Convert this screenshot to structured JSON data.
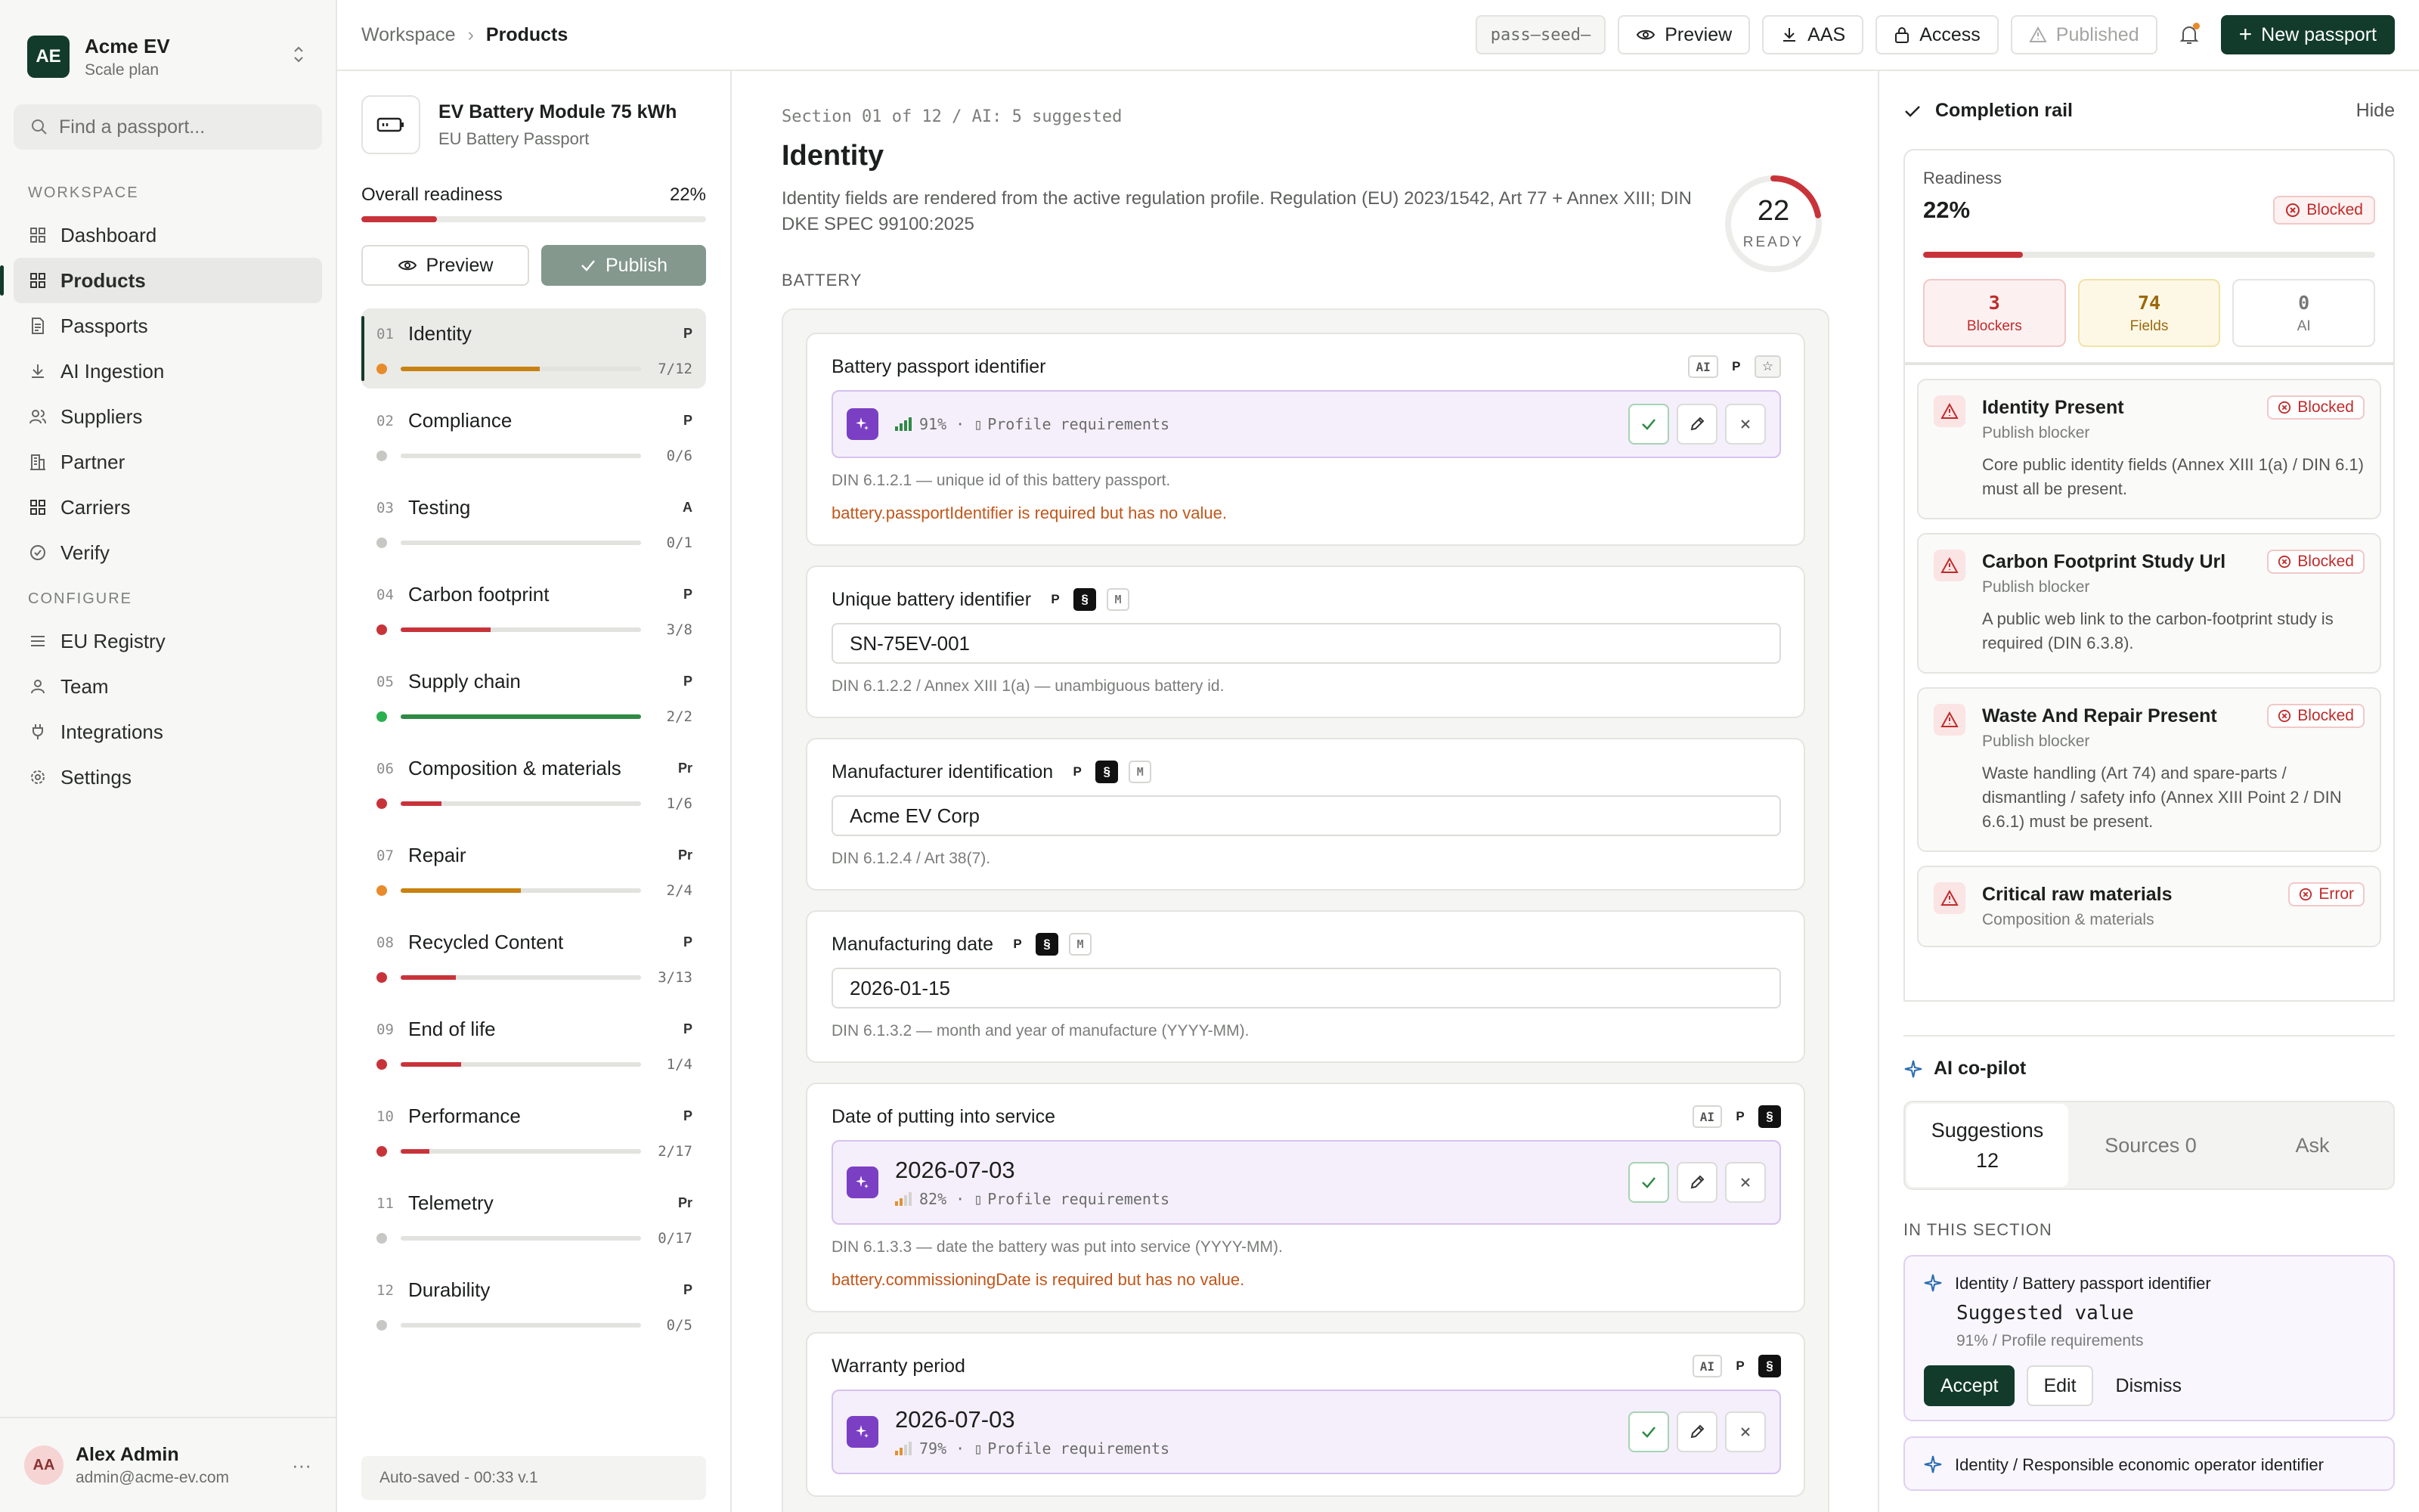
{
  "org": {
    "badge": "AE",
    "name": "Acme EV",
    "plan": "Scale plan"
  },
  "search": {
    "placeholder": "Find a passport..."
  },
  "nav": {
    "workspace_label": "WORKSPACE",
    "workspace": [
      {
        "label": "Dashboard",
        "icon": "dashboard-icon"
      },
      {
        "label": "Products",
        "icon": "grid-icon",
        "active": true
      },
      {
        "label": "Passports",
        "icon": "document-icon"
      },
      {
        "label": "AI Ingestion",
        "icon": "download-icon"
      },
      {
        "label": "Suppliers",
        "icon": "users-icon"
      },
      {
        "label": "Partner",
        "icon": "building-icon"
      },
      {
        "label": "Carriers",
        "icon": "grid-icon"
      },
      {
        "label": "Verify",
        "icon": "check-circle-icon"
      }
    ],
    "configure_label": "CONFIGURE",
    "configure": [
      {
        "label": "EU Registry",
        "icon": "list-icon"
      },
      {
        "label": "Team",
        "icon": "user-icon"
      },
      {
        "label": "Integrations",
        "icon": "plug-icon"
      },
      {
        "label": "Settings",
        "icon": "gear-icon"
      }
    ]
  },
  "user": {
    "initials": "AA",
    "name": "Alex Admin",
    "email": "admin@acme-ev.com"
  },
  "topbar": {
    "crumb_root": "Workspace",
    "crumb_current": "Products",
    "seed": "pass—seed—",
    "preview": "Preview",
    "aas": "AAS",
    "access": "Access",
    "published": "Published",
    "new_passport": "New passport"
  },
  "product": {
    "name": "EV Battery Module 75 kWh",
    "subtitle": "EU Battery Passport",
    "readiness_label": "Overall readiness",
    "readiness_pct": "22%",
    "readiness_value": 0.22,
    "preview": "Preview",
    "publish": "Publish",
    "autosave": "Auto-saved - 00:33 v.1",
    "sections": [
      {
        "num": "01",
        "title": "Identity",
        "tag": "P",
        "count": "7/12",
        "progress": 0.58,
        "color": "#c8820f",
        "dot": "#e88b2b",
        "active": true
      },
      {
        "num": "02",
        "title": "Compliance",
        "tag": "P",
        "count": "0/6",
        "progress": 0,
        "color": "#c7c7c4",
        "dot": "#c7c7c4"
      },
      {
        "num": "03",
        "title": "Testing",
        "tag": "A",
        "count": "0/1",
        "progress": 0,
        "color": "#c7c7c4",
        "dot": "#c7c7c4"
      },
      {
        "num": "04",
        "title": "Carbon footprint",
        "tag": "P",
        "count": "3/8",
        "progress": 0.375,
        "color": "#c8333a",
        "dot": "#c8333a"
      },
      {
        "num": "05",
        "title": "Supply chain",
        "tag": "P",
        "count": "2/2",
        "progress": 1,
        "color": "#2f8a44",
        "dot": "#2bb04f"
      },
      {
        "num": "06",
        "title": "Composition & materials",
        "tag": "Pr",
        "count": "1/6",
        "progress": 0.17,
        "color": "#c8333a",
        "dot": "#c8333a"
      },
      {
        "num": "07",
        "title": "Repair",
        "tag": "Pr",
        "count": "2/4",
        "progress": 0.5,
        "color": "#c8820f",
        "dot": "#e88b2b"
      },
      {
        "num": "08",
        "title": "Recycled Content",
        "tag": "P",
        "count": "3/13",
        "progress": 0.23,
        "color": "#c8333a",
        "dot": "#c8333a"
      },
      {
        "num": "09",
        "title": "End of life",
        "tag": "P",
        "count": "1/4",
        "progress": 0.25,
        "color": "#c8333a",
        "dot": "#c8333a"
      },
      {
        "num": "10",
        "title": "Performance",
        "tag": "P",
        "count": "2/17",
        "progress": 0.12,
        "color": "#c8333a",
        "dot": "#c8333a"
      },
      {
        "num": "11",
        "title": "Telemetry",
        "tag": "Pr",
        "count": "0/17",
        "progress": 0,
        "color": "#c7c7c4",
        "dot": "#c7c7c4"
      },
      {
        "num": "12",
        "title": "Durability",
        "tag": "P",
        "count": "0/5",
        "progress": 0,
        "color": "#c7c7c4",
        "dot": "#c7c7c4"
      }
    ]
  },
  "form": {
    "meta": "Section 01 of 12 / AI: 5 suggested",
    "title": "Identity",
    "description": "Identity fields are rendered from the active regulation profile. Regulation (EU) 2023/1542, Art 77 + Annex XIII; DIN DKE SPEC 99100:2025",
    "ring_value": "22",
    "ring_fraction": 0.22,
    "ring_label": "READY",
    "group_label": "BATTERY",
    "fields": [
      {
        "label": "Battery passport identifier",
        "badges": [
          "AI",
          "P",
          "star"
        ],
        "badges_inline": false,
        "kind": "suggestion",
        "value": "",
        "confidence": "91%",
        "strength": "high",
        "source": "Profile requirements",
        "help": "DIN 6.1.2.1 — unique id of this battery passport.",
        "error": "battery.passportIdentifier is required but has no value."
      },
      {
        "label": "Unique battery identifier",
        "badges": [
          "P",
          "§",
          "M"
        ],
        "badges_inline": true,
        "kind": "input",
        "value": "SN-75EV-001",
        "help": "DIN 6.1.2.2 / Annex XIII 1(a) — unambiguous battery id.",
        "error": ""
      },
      {
        "label": "Manufacturer identification",
        "badges": [
          "P",
          "§",
          "M"
        ],
        "badges_inline": true,
        "kind": "input",
        "value": "Acme EV Corp",
        "help": "DIN 6.1.2.4 / Art 38(7).",
        "error": ""
      },
      {
        "label": "Manufacturing date",
        "badges": [
          "P",
          "§",
          "M"
        ],
        "badges_inline": true,
        "kind": "input",
        "value": "2026-01-15",
        "help": "DIN 6.1.3.2 — month and year of manufacture (YYYY-MM).",
        "error": ""
      },
      {
        "label": "Date of putting into service",
        "badges": [
          "AI",
          "P",
          "§"
        ],
        "badges_inline": false,
        "kind": "suggestion",
        "value": "2026-07-03",
        "confidence": "82%",
        "strength": "mid",
        "source": "Profile requirements",
        "help": "DIN 6.1.3.3 — date the battery was put into service (YYYY-MM).",
        "error": "battery.commissioningDate is required but has no value."
      },
      {
        "label": "Warranty period",
        "badges": [
          "AI",
          "P",
          "§"
        ],
        "badges_inline": false,
        "kind": "suggestion",
        "value": "2026-07-03",
        "confidence": "79%",
        "strength": "mid",
        "source": "Profile requirements",
        "help": "",
        "error": ""
      }
    ]
  },
  "rail": {
    "title": "Completion rail",
    "hide": "Hide",
    "readiness_label": "Readiness",
    "readiness_pct": "22%",
    "readiness_value": 0.22,
    "status": "Blocked",
    "stats": [
      {
        "n": "3",
        "label": "Blockers",
        "tone": "red"
      },
      {
        "n": "74",
        "label": "Fields",
        "tone": "amber"
      },
      {
        "n": "0",
        "label": "AI",
        "tone": "gray"
      }
    ],
    "blockers": [
      {
        "title": "Identity Present",
        "status": "Blocked",
        "sub": "Publish blocker",
        "desc": "Core public identity fields (Annex XIII 1(a) / DIN 6.1) must all be present."
      },
      {
        "title": "Carbon Footprint Study Url",
        "status": "Blocked",
        "sub": "Publish blocker",
        "desc": "A public web link to the carbon-footprint study is required (DIN 6.3.8)."
      },
      {
        "title": "Waste And Repair Present",
        "status": "Blocked",
        "sub": "Publish blocker",
        "desc": "Waste handling (Art 74) and spare-parts / dismantling / safety info (Annex XIII Point 2 / DIN 6.6.1) must be present."
      },
      {
        "title": "Critical raw materials",
        "status": "Error",
        "sub": "Composition & materials",
        "desc": ""
      }
    ],
    "copilot": {
      "title": "AI co-pilot",
      "tabs": [
        {
          "label": "Suggestions",
          "count": "12",
          "active": true
        },
        {
          "label": "Sources 0",
          "count": ""
        },
        {
          "label": "Ask",
          "count": ""
        }
      ],
      "section_label": "IN THIS SECTION",
      "suggestions": [
        {
          "title": "Identity / Battery passport identifier",
          "value": "Suggested value",
          "meta": "91% / Profile requirements",
          "accept": "Accept",
          "edit": "Edit",
          "dismiss": "Dismiss"
        },
        {
          "title": "Identity / Responsible economic operator identifier",
          "value": "",
          "meta": ""
        }
      ]
    }
  }
}
